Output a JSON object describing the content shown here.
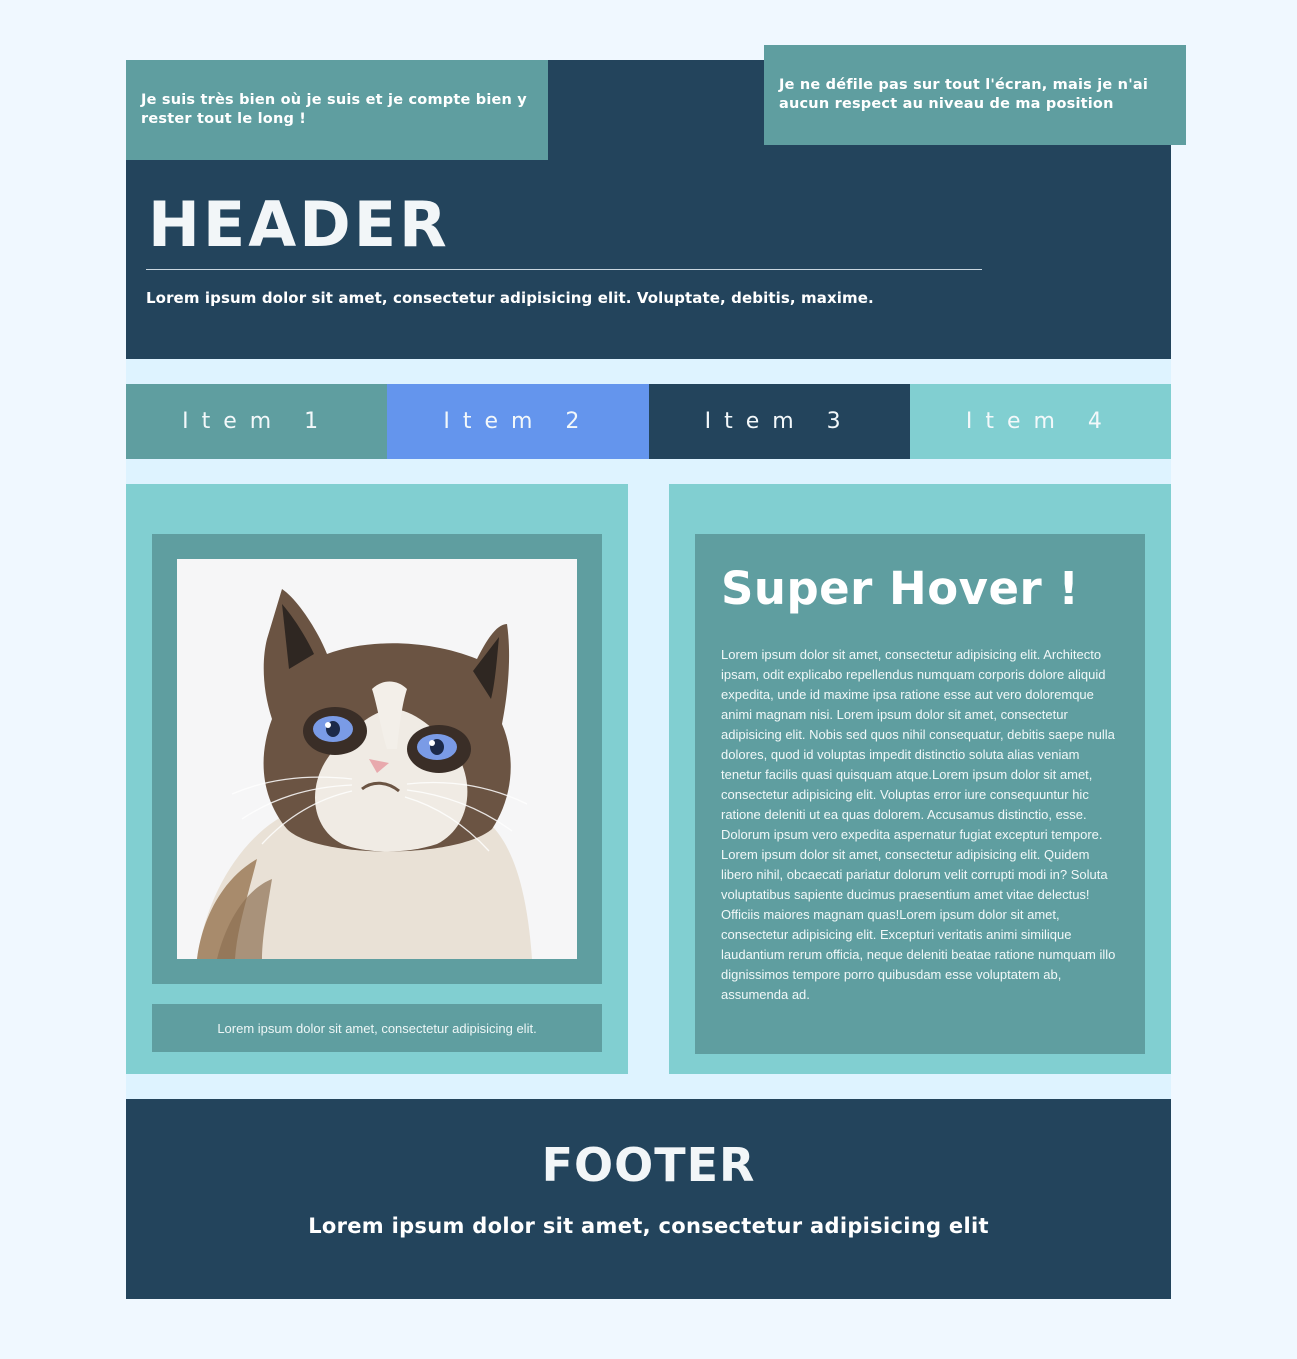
{
  "sticky_box": {
    "text": "Je suis très bien où je suis et je compte bien y rester tout le long !"
  },
  "fixed_box": {
    "text": "Je ne défile pas sur tout l'écran, mais je n'ai aucun respect au niveau de ma position"
  },
  "header": {
    "title": "HEADER",
    "subtitle": "Lorem ipsum dolor sit amet, consectetur adipisicing elit. Voluptate, debitis, maxime."
  },
  "nav": {
    "items": [
      {
        "label": "Item 1",
        "color": "#5f9ea0"
      },
      {
        "label": "Item 2",
        "color": "#6495ed"
      },
      {
        "label": "Item 3",
        "color": "#23445c"
      },
      {
        "label": "Item 4",
        "color": "#81cfd1"
      }
    ]
  },
  "photo_card": {
    "image": "grumpy-cat-photo",
    "caption": "Lorem ipsum dolor sit amet, consectetur adipisicing elit."
  },
  "hover_card": {
    "title": "Super Hover !",
    "text": "Lorem ipsum dolor sit amet, consectetur adipisicing elit. Architecto ipsam, odit explicabo repellendus numquam corporis dolore aliquid expedita, unde id maxime ipsa ratione esse aut vero doloremque animi magnam nisi. Lorem ipsum dolor sit amet, consectetur adipisicing elit. Nobis sed quos nihil consequatur, debitis saepe nulla dolores, quod id voluptas impedit distinctio soluta alias veniam tenetur facilis quasi quisquam atque.Lorem ipsum dolor sit amet, consectetur adipisicing elit. Voluptas error iure consequuntur hic ratione deleniti ut ea quas dolorem. Accusamus distinctio, esse. Dolorum ipsum vero expedita aspernatur fugiat excepturi tempore. Lorem ipsum dolor sit amet, consectetur adipisicing elit. Quidem libero nihil, obcaecati pariatur dolorum velit corrupti modi in? Soluta voluptatibus sapiente ducimus praesentium amet vitae delectus! Officiis maiores magnam quas!Lorem ipsum dolor sit amet, consectetur adipisicing elit. Excepturi veritatis animi similique laudantium rerum officia, neque deleniti beatae ratione numquam illo dignissimos tempore porro quibusdam esse voluptatem ab, assumenda ad."
  },
  "footer": {
    "title": "FOOTER",
    "text": "Lorem ipsum dolor sit amet, consectetur adipisicing elit"
  },
  "colors": {
    "page_bg": "#f0f8ff",
    "content_bg": "#def3ff",
    "dark": "#23445c",
    "teal": "#5f9ea0",
    "light_teal": "#81cfd1",
    "blue": "#6495ed"
  }
}
